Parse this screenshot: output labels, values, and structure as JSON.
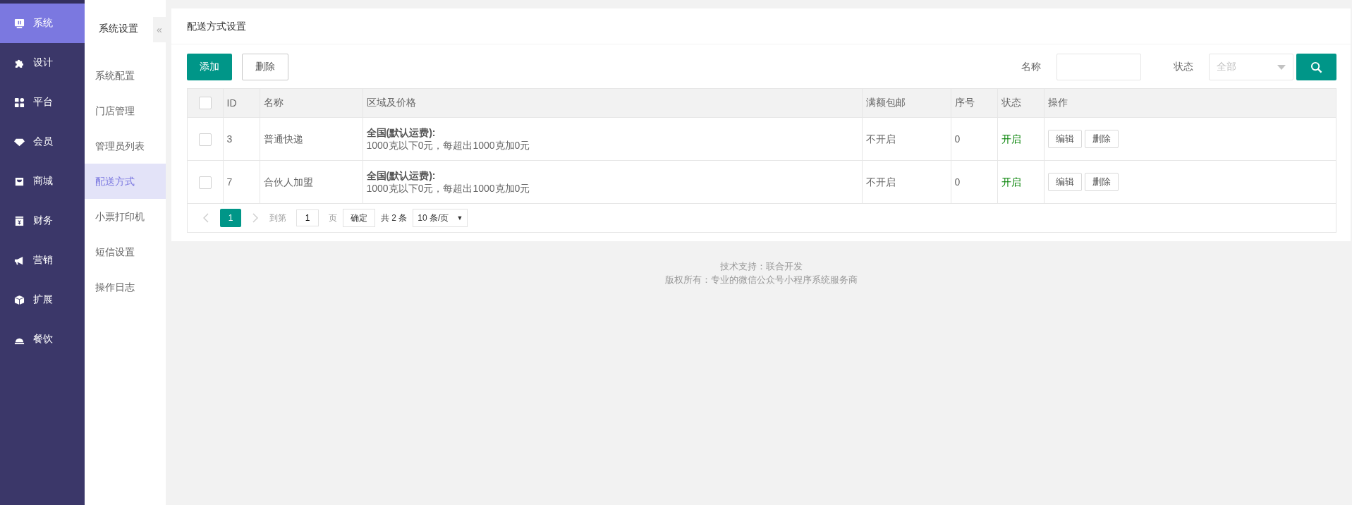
{
  "sidebar": {
    "items": [
      {
        "label": "系统",
        "selected": true
      },
      {
        "label": "设计",
        "selected": false
      },
      {
        "label": "平台",
        "selected": false
      },
      {
        "label": "会员",
        "selected": false
      },
      {
        "label": "商城",
        "selected": false
      },
      {
        "label": "财务",
        "selected": false
      },
      {
        "label": "营销",
        "selected": false
      },
      {
        "label": "扩展",
        "selected": false
      },
      {
        "label": "餐饮",
        "selected": false
      }
    ]
  },
  "submenu": {
    "title": "系统设置",
    "collapse": "«",
    "items": [
      {
        "label": "系统配置",
        "selected": false
      },
      {
        "label": "门店管理",
        "selected": false
      },
      {
        "label": "管理员列表",
        "selected": false
      },
      {
        "label": "配送方式",
        "selected": true
      },
      {
        "label": "小票打印机",
        "selected": false
      },
      {
        "label": "短信设置",
        "selected": false
      },
      {
        "label": "操作日志",
        "selected": false
      }
    ]
  },
  "page": {
    "title": "配送方式设置"
  },
  "toolbar": {
    "add_button": "添加",
    "delete_button": "删除",
    "name_label": "名称",
    "status_label": "状态",
    "status_select": {
      "placeholder": "全部"
    }
  },
  "table": {
    "select_all_checked": false,
    "columns": [
      "ID",
      "名称",
      "区域及价格",
      "满额包邮",
      "序号",
      "状态",
      "操作"
    ],
    "rows": [
      {
        "checked": false,
        "id": "3",
        "name": "普通快递",
        "region_title": "全国(默认运费):",
        "region_detail": "1000克以下0元，每超出1000克加0元",
        "free_shipping": "不开启",
        "order": "0",
        "status": "开启",
        "enabled": true,
        "actions": [
          "编辑",
          "删除"
        ]
      },
      {
        "checked": false,
        "id": "7",
        "name": "合伙人加盟",
        "region_title": "全国(默认运费):",
        "region_detail": "1000克以下0元，每超出1000克加0元",
        "free_shipping": "不开启",
        "order": "0",
        "status": "开启",
        "enabled": true,
        "actions": [
          "编辑",
          "删除"
        ]
      }
    ]
  },
  "pagination": {
    "pages": [
      {
        "label": "1",
        "selected": true
      }
    ],
    "goto_label": "到第",
    "goto_value": "1",
    "page_label": "页",
    "confirm": "确定",
    "total": "共 2 条",
    "page_size": "10 条/页",
    "page_size_caret": "▼"
  },
  "footer": [
    "技术支持：联合开发",
    "版权所有：专业的微信公众号小程序系统服务商"
  ]
}
